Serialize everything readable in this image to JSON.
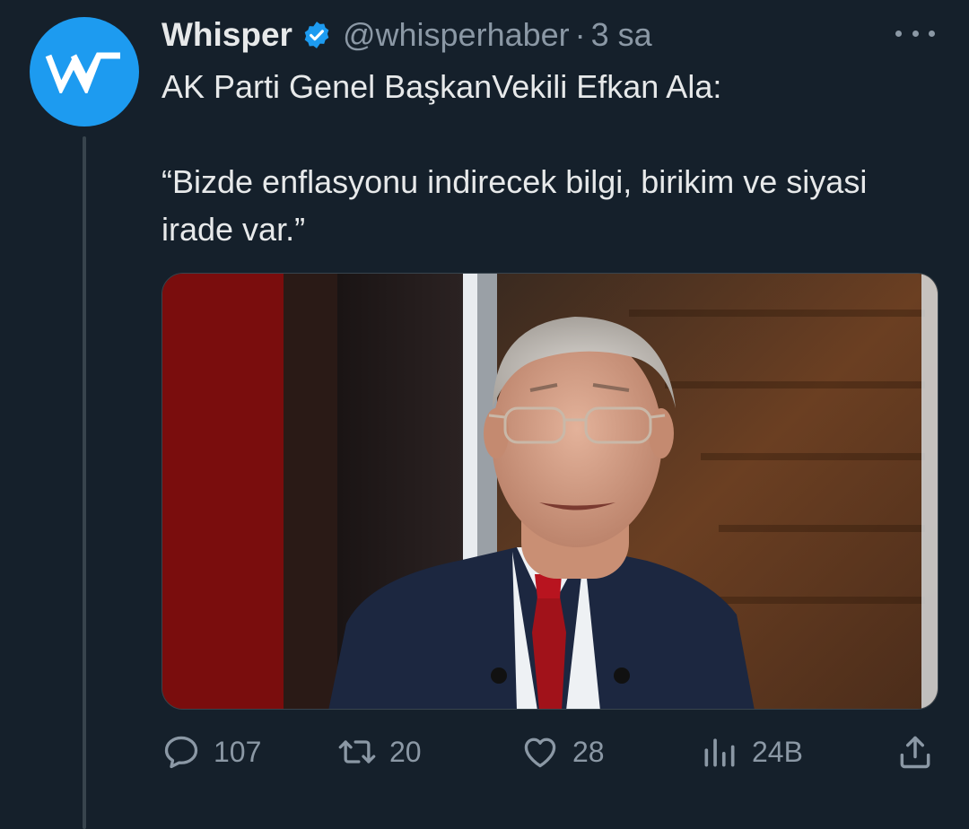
{
  "colors": {
    "background": "#15202b",
    "brand_blue": "#1d9bf0",
    "text_primary": "#e7e9ea",
    "text_secondary": "#8b98a5"
  },
  "author": {
    "display_name": "Whisper",
    "handle": "@whisperhaber",
    "separator": "·",
    "time": "3 sa",
    "verified": true,
    "avatar_icon": "whisper-logo-icon"
  },
  "tweet": {
    "line1": "AK Parti Genel BaşkanVekili Efkan Ala:",
    "line2": "“Bizde enflasyonu indirecek bilgi, birikim ve siyasi irade var.”"
  },
  "media": {
    "type": "photo"
  },
  "actions": {
    "reply": {
      "icon": "reply-icon",
      "count": "107"
    },
    "retweet": {
      "icon": "retweet-icon",
      "count": "20"
    },
    "like": {
      "icon": "heart-icon",
      "count": "28"
    },
    "views": {
      "icon": "views-icon",
      "count": "24B"
    },
    "share": {
      "icon": "share-icon"
    }
  }
}
